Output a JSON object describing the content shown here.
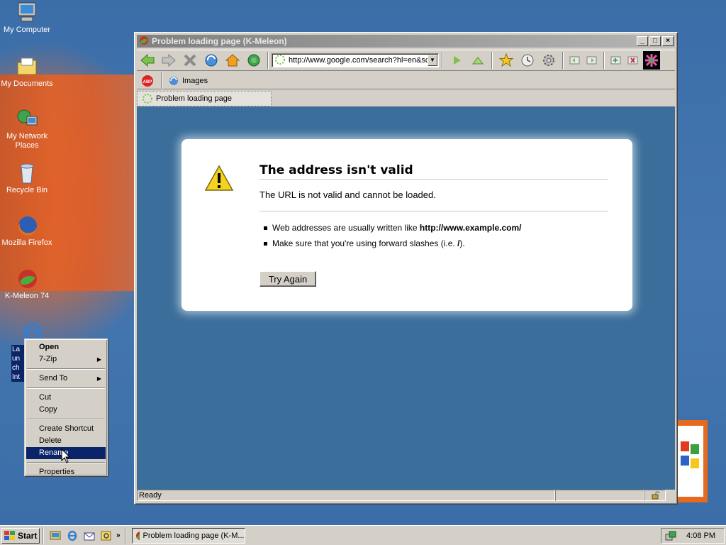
{
  "desktop": {
    "icons": [
      {
        "label": "My Computer"
      },
      {
        "label": "My Documents"
      },
      {
        "label": "My Network Places"
      },
      {
        "label": "Recycle Bin"
      },
      {
        "label": "Mozilla Firefox"
      },
      {
        "label": "K-Meleon 74"
      },
      {
        "label": "Launch Internet Explorer Browser"
      }
    ]
  },
  "window": {
    "title": "Problem loading page (K-Meleon)",
    "url": "http://www.google.com/search?hl=en&sc",
    "toolbar2": {
      "images_label": "Images"
    },
    "tab_label": "Problem loading page",
    "status": "Ready"
  },
  "error": {
    "title": "The address isn't valid",
    "description": "The URL is not valid and cannot be loaded.",
    "bullet1_prefix": "Web addresses are usually written like ",
    "bullet1_bold": "http://www.example.com/",
    "bullet2_prefix": "Make sure that you're using forward slashes (i.e. ",
    "bullet2_bold": "/",
    "bullet2_suffix": ").",
    "button": "Try Again"
  },
  "context_menu": {
    "items": [
      "Open",
      "7-Zip",
      "Send To",
      "Cut",
      "Copy",
      "Create Shortcut",
      "Delete",
      "Rename",
      "Properties"
    ]
  },
  "taskbar": {
    "start": "Start",
    "task": "Problem loading page (K-M...",
    "clock": "4:08 PM"
  },
  "colors": {
    "desktop": "#3a6ea5",
    "selection": "#0a246a",
    "content_bg": "#3b6e9b"
  }
}
